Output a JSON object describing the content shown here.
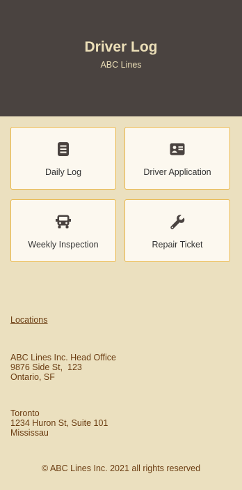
{
  "header": {
    "title": "Driver Log",
    "subtitle": "ABC Lines"
  },
  "cards": [
    {
      "label": "Daily Log",
      "icon": "list-icon"
    },
    {
      "label": "Driver Application",
      "icon": "id-card-icon"
    },
    {
      "label": "Weekly Inspection",
      "icon": "truck-icon"
    },
    {
      "label": "Repair Ticket",
      "icon": "wrench-icon"
    }
  ],
  "locations_link": "Locations",
  "addresses": [
    {
      "line1": "ABC Lines Inc. Head Office",
      "line2": "9876 Side St,  123",
      "line3": "Ontario, SF"
    },
    {
      "line1": "Toronto",
      "line2": "1234 Huron St, Suite 101",
      "line3": "Mississau"
    }
  ],
  "footer": "© ABC Lines Inc. 2021 all rights reserved",
  "colors": {
    "header_bg": "#4a4340",
    "page_bg": "#ebe0bf",
    "card_border": "#e9b74a",
    "text_brown": "#6b3d12"
  }
}
